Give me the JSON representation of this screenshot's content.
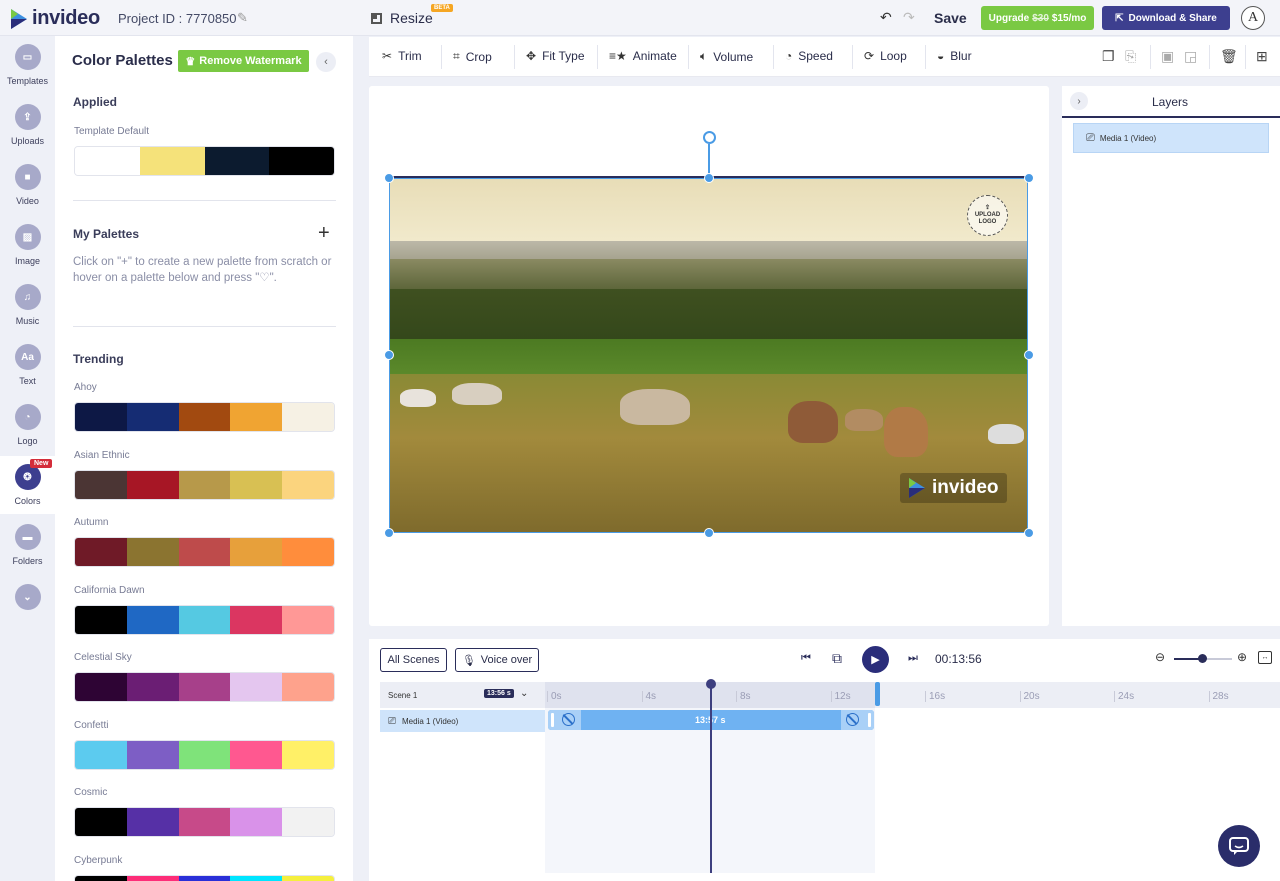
{
  "header": {
    "logo_text": "invideo",
    "project_id": "Project ID : 7770850",
    "resize_label": "Resize",
    "beta_badge": "BETA",
    "save_label": "Save",
    "upgrade_label": "Upgrade",
    "upgrade_old_price": "$30",
    "upgrade_new_price": "$15/mo",
    "download_label": "Download & Share",
    "avatar_letter": "A"
  },
  "leftnav": {
    "items": [
      {
        "label": "Templates",
        "icon": "templates-icon"
      },
      {
        "label": "Uploads",
        "icon": "upload-icon"
      },
      {
        "label": "Video",
        "icon": "video-icon"
      },
      {
        "label": "Image",
        "icon": "image-icon"
      },
      {
        "label": "Music",
        "icon": "music-icon"
      },
      {
        "label": "Text",
        "icon": "text-icon",
        "glyph": "Aa"
      },
      {
        "label": "Logo",
        "icon": "logo-icon"
      },
      {
        "label": "Colors",
        "icon": "palette-icon",
        "badge": "New",
        "active": true
      },
      {
        "label": "Folders",
        "icon": "folder-icon"
      }
    ]
  },
  "panel": {
    "title": "Color Palettes",
    "remove_watermark": "Remove Watermark",
    "applied_title": "Applied",
    "template_default": {
      "name": "Template Default",
      "colors": [
        "#ffffff",
        "#f5e27a",
        "#0c1b2f",
        "#000000"
      ]
    },
    "my_palettes_title": "My Palettes",
    "my_palettes_help": "Click on \"+\" to create a new palette from scratch or hover on a palette below and press \"♡\".",
    "trending_title": "Trending",
    "trending": [
      {
        "name": "Ahoy",
        "colors": [
          "#0d1845",
          "#152c73",
          "#a24a10",
          "#f0a432",
          "#f6f1e4"
        ]
      },
      {
        "name": "Asian Ethnic",
        "colors": [
          "#4b3534",
          "#a71625",
          "#b7994a",
          "#d8c053",
          "#fbd47e"
        ]
      },
      {
        "name": "Autumn",
        "colors": [
          "#6f1a27",
          "#8b7430",
          "#be4b4b",
          "#e7a03b",
          "#ff8d3c"
        ]
      },
      {
        "name": "California Dawn",
        "colors": [
          "#000000",
          "#1f68c4",
          "#55c9e2",
          "#db3661",
          "#ff9896"
        ]
      },
      {
        "name": "Celestial Sky",
        "colors": [
          "#2e0434",
          "#6b1e74",
          "#a7408a",
          "#e4c6ef",
          "#fea28c"
        ]
      },
      {
        "name": "Confetti",
        "colors": [
          "#5ccbef",
          "#7d5ec5",
          "#7fe37a",
          "#ff5890",
          "#fff067"
        ]
      },
      {
        "name": "Cosmic",
        "colors": [
          "#000000",
          "#5630a6",
          "#c74a89",
          "#d992e9",
          "#f2f2f2"
        ]
      },
      {
        "name": "Cyberpunk",
        "colors": [
          "#000000",
          "#fd2d78",
          "#2a2fd8",
          "#00e5ff",
          "#f5ef3e"
        ]
      }
    ]
  },
  "toolbar": {
    "tools": [
      {
        "label": "Trim",
        "icon": "scissors-icon",
        "glyph": "✂"
      },
      {
        "label": "Crop",
        "icon": "crop-icon",
        "glyph": "⌗"
      },
      {
        "label": "Fit Type",
        "icon": "fit-type-icon",
        "glyph": "✥"
      },
      {
        "label": "Animate",
        "icon": "animate-icon",
        "glyph": "≡★"
      },
      {
        "label": "Volume",
        "icon": "volume-icon",
        "glyph": "🔈︎"
      },
      {
        "label": "Speed",
        "icon": "speed-icon",
        "glyph": "◔"
      },
      {
        "label": "Loop",
        "icon": "loop-icon",
        "glyph": "⟳"
      },
      {
        "label": "Blur",
        "icon": "blur-icon",
        "glyph": "◒"
      }
    ]
  },
  "canvas": {
    "upload_logo_line1": "UPLOAD",
    "upload_logo_line2": "LOGO",
    "watermark_text": "invideo"
  },
  "layers": {
    "title": "Layers",
    "items": [
      {
        "label": "Media 1 (Video)"
      }
    ]
  },
  "timeline": {
    "all_scenes": "All Scenes",
    "voice_over": "Voice over",
    "timecode": "00:13:56",
    "scene_label": "Scene 1",
    "scene_duration": "13:56 s",
    "media_label": "Media 1 (Video)",
    "clip_label": "13:57 s",
    "ticks": [
      "0s",
      "4s",
      "8s",
      "12s",
      "16s",
      "20s",
      "24s",
      "28s"
    ]
  },
  "colors": {
    "accent_green": "#7ac943",
    "accent_navy": "#3d3f8f",
    "selection_blue": "#4a9be5"
  }
}
